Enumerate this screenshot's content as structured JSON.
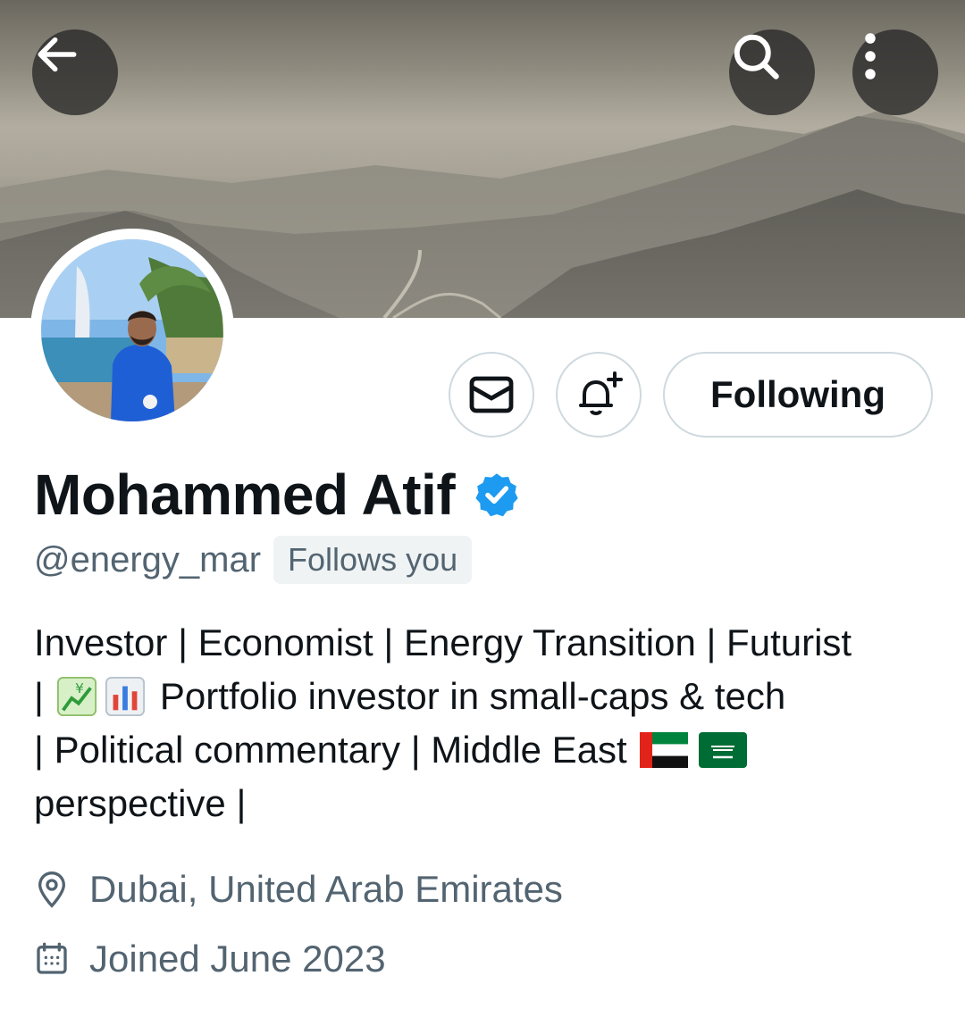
{
  "header": {
    "back_icon": "arrow-left-icon",
    "search_icon": "search-icon",
    "more_icon": "more-vertical-icon"
  },
  "profile": {
    "display_name": "Mohammed Atif",
    "verified": true,
    "handle": "@energy_mar",
    "follows_you_label": "Follows you",
    "bio_lines": [
      "Investor | Economist | Energy Transition | Futurist",
      "Portfolio investor in small-caps & tech",
      "| Political commentary | Middle East",
      "perspective |"
    ],
    "bio_line2_prefix": "|",
    "location": "Dubai, United Arab Emirates",
    "joined": "Joined June 2023"
  },
  "actions": {
    "message_icon": "envelope-icon",
    "notify_icon": "bell-plus-icon",
    "following_label": "Following"
  },
  "colors": {
    "verified_blue": "#1d9bf0",
    "secondary_text": "#536471",
    "border": "#cfd9de"
  }
}
